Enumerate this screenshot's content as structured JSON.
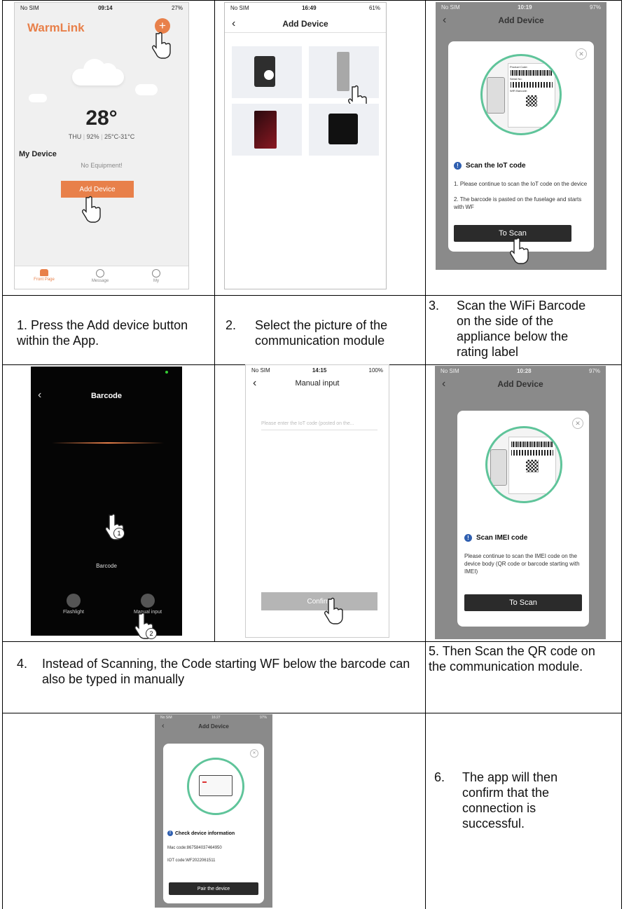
{
  "steps": {
    "s1": "1. Press the Add device button within the App.",
    "s2_num": "2.",
    "s2": "Select the picture of the communication module",
    "s3_num": "3.",
    "s3": "Scan the WiFi Barcode on the side of the appliance below the rating label",
    "s4_num": "4.",
    "s4": "Instead of Scanning, the Code starting WF below the barcode can also be typed in manually",
    "s5": "5. Then Scan the QR code on the communication module.",
    "s6_num": "6.",
    "s6": "The app will then confirm that the connection is successful."
  },
  "shot1": {
    "carrier": "No SIM",
    "time": "09:14",
    "battery": "27%",
    "app_name": "WarmLink",
    "temperature": "28°",
    "day": "THU",
    "humidity": "92%",
    "temp_range": "25°C-31°C",
    "my_device": "My Device",
    "no_equipment": "No Equipment!",
    "add_device": "Add Device",
    "tabs": [
      "Front Page",
      "Message",
      "My"
    ]
  },
  "shot2": {
    "carrier": "No SIM",
    "time": "16:49",
    "battery": "61%",
    "title": "Add Device"
  },
  "shot3": {
    "carrier": "No SIM",
    "time": "10:19",
    "battery": "97%",
    "title": "Add Device",
    "label_product_code": "Product Code:",
    "label_serial": "Serial No:",
    "label_wifi_barcode": "WiFi Barcode:",
    "heading": "Scan the IoT code",
    "line1": "1. Please continue to scan the IoT code on the device",
    "line2": "2. The barcode is pasted on the fuselage and starts with WF",
    "button": "To Scan"
  },
  "shot4": {
    "title": "Barcode",
    "barcode_label": "Barcode",
    "flashlight": "Flashlight",
    "manual_input": "Manual input",
    "marker1": "1",
    "marker2": "2"
  },
  "shot5": {
    "carrier": "No SIM",
    "time": "14:15",
    "battery": "100%",
    "title": "Manual input",
    "placeholder": "Please enter the IoT code (posted on the...",
    "confirm": "Confirm"
  },
  "shot6": {
    "carrier": "No SIM",
    "time": "10:28",
    "battery": "97%",
    "title": "Add Device",
    "heading": "Scan IMEI code",
    "body": "Please continue to scan the IMEI code on the device body (QR code or barcode starting with IMEI)",
    "button": "To Scan"
  },
  "shot7": {
    "carrier": "No SIM",
    "time": "16:27",
    "battery": "97%",
    "title": "Add Device",
    "heading": "Check device information",
    "mac": "Mac code:867584037464950",
    "iot": "IOT code:WF2022061511",
    "button": "Pair the device"
  },
  "colors": {
    "accent": "#e8804a",
    "dark_button": "#2b2b2b",
    "info_blue": "#2f5fb0",
    "teal_ring": "#5fc49a",
    "shade": "#8a8a8a"
  }
}
